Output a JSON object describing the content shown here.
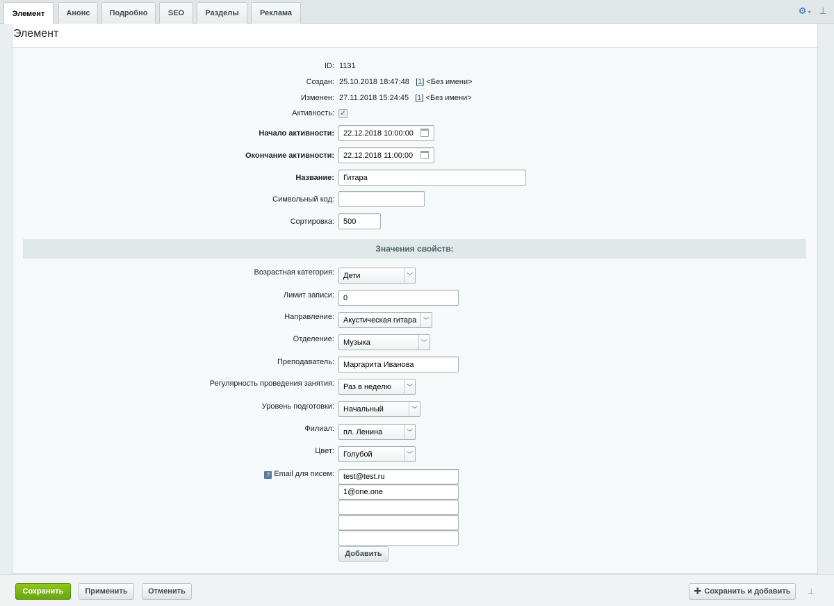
{
  "tabs": [
    "Элемент",
    "Анонс",
    "Подробно",
    "SEO",
    "Разделы",
    "Реклама"
  ],
  "page_title": "Элемент",
  "fields": {
    "id": {
      "label": "ID:",
      "value": "1131"
    },
    "created": {
      "label": "Создан:",
      "value": "25.10.2018 18:47:48",
      "user_link": "1",
      "user_name": "<Без имени>"
    },
    "modified": {
      "label": "Изменен:",
      "value": "27.11.2018 15:24:45",
      "user_link": "1",
      "user_name": "<Без имени>"
    },
    "active": {
      "label": "Активность:",
      "checked": true
    },
    "active_from": {
      "label": "Начало активности:",
      "value": "22.12.2018 10:00:00"
    },
    "active_to": {
      "label": "Окончание активности:",
      "value": "22.12.2018 11:00:00"
    },
    "name": {
      "label": "Название:",
      "value": "Гитара"
    },
    "code": {
      "label": "Символьный код:",
      "value": ""
    },
    "sort": {
      "label": "Сортировка:",
      "value": "500"
    }
  },
  "section_title": "Значения свойств:",
  "props": {
    "age": {
      "label": "Возрастная категория:",
      "value": "Дети"
    },
    "limit": {
      "label": "Лимит записи:",
      "value": "0"
    },
    "direction": {
      "label": "Направление:",
      "value": "Акустическая гитара"
    },
    "department": {
      "label": "Отделение:",
      "value": "Музыка"
    },
    "teacher": {
      "label": "Преподаватель:",
      "value": "Маргарита Иванова"
    },
    "regularity": {
      "label": "Регулярность проведения занятия:",
      "value": "Раз в неделю"
    },
    "level": {
      "label": "Уровень подготовки:",
      "value": "Начальный"
    },
    "branch": {
      "label": "Филиал:",
      "value": "пл. Ленина"
    },
    "color": {
      "label": "Цвет:",
      "value": "Голубой"
    },
    "email": {
      "label": "Email для писем:",
      "values": [
        "test@test.ru",
        "1@one.one",
        "",
        "",
        ""
      ],
      "add_label": "Добавить"
    }
  },
  "footer": {
    "save": "Сохранить",
    "apply": "Применить",
    "cancel": "Отменить",
    "save_add": "Сохранить и добавить"
  },
  "colors": {
    "save_button": "#7ab516",
    "link": "#2067b0"
  }
}
